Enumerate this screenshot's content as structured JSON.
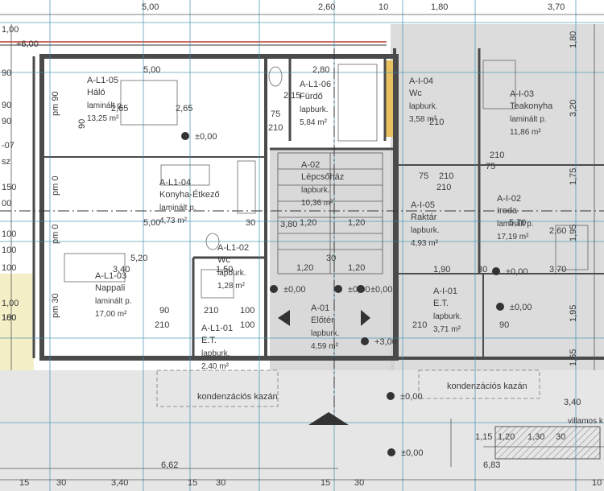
{
  "colors": {
    "wall": "#4a4a4a",
    "grid_blue": "#3a8fb0",
    "dim_line": "#555555",
    "axis_red": "#c0392b",
    "shade": "#d8d8d8",
    "yellow_strip": "#f4efc6",
    "orange_strip": "#e8c060"
  },
  "top_dims": [
    "5,00",
    "2,60",
    "10",
    "1,80",
    "3,70"
  ],
  "left_dims": [
    "1,00",
    "+6,00",
    "90",
    "90",
    "90",
    "-07",
    "sz",
    "150",
    "00",
    "100",
    "100",
    "100",
    "1,00",
    "100",
    "180"
  ],
  "rooms": [
    {
      "id": "A-L1-05",
      "name": "Háló",
      "finish": "laminált p.",
      "area": "13,25 m²",
      "area_num": 13.25
    },
    {
      "id": "A-L1-06",
      "name": "Fürdő",
      "finish": "lapburk.",
      "area": "5,84 m²",
      "area_num": 5.84
    },
    {
      "id": "A-I-04",
      "name": "Wc",
      "finish": "lapburk.",
      "area": "3,58 m²",
      "area_num": 3.58
    },
    {
      "id": "A-I-03",
      "name": "Teakonyha",
      "finish": "laminált p.",
      "area": "11,86 m²",
      "area_num": 11.86
    },
    {
      "id": "A-02",
      "name": "Lépcsőház",
      "finish": "lapburk.",
      "area": "10,36 m²",
      "area_num": 10.36
    },
    {
      "id": "A-L1-04",
      "name": "Konyha-Étkező",
      "finish": "laminált p.",
      "area": "4,73 m²",
      "area_num": 4.73
    },
    {
      "id": "A-I-05",
      "name": "Raktár",
      "finish": "lapburk.",
      "area": "4,93 m²",
      "area_num": 4.93
    },
    {
      "id": "A-I-02",
      "name": "Iroda",
      "finish": "laminált p.",
      "area": "17,19 m²",
      "area_num": 17.19
    },
    {
      "id": "A-L1-02",
      "name": "Wc",
      "finish": "lapburk.",
      "area": "1,28 m²",
      "area_num": 1.28
    },
    {
      "id": "A-L1-03",
      "name": "Nappali",
      "finish": "laminált p.",
      "area": "17,00 m²",
      "area_num": 17.0
    },
    {
      "id": "A-L1-01",
      "name": "E.T.",
      "finish": "lapburk.",
      "area": "2,40 m²",
      "area_num": 2.4
    },
    {
      "id": "A-01",
      "name": "Előtér",
      "finish": "lapburk.",
      "area": "4,59 m²",
      "area_num": 4.59
    },
    {
      "id": "A-I-01",
      "name": "E.T.",
      "finish": "lapburk.",
      "area": "3,71 m²",
      "area_num": 3.71
    }
  ],
  "room_labels": {
    "r0": {
      "id": "A-L1-05",
      "name": "Háló",
      "finish": "laminált p.",
      "area": "13,25 m²"
    },
    "r1": {
      "id": "A-L1-06",
      "name": "Fürdő",
      "finish": "lapburk.",
      "area": "5,84 m²"
    },
    "r2": {
      "id": "A-I-04",
      "name": "Wc",
      "finish": "lapburk.",
      "area": "3,58 m²"
    },
    "r3": {
      "id": "A-I-03",
      "name": "Teakonyha",
      "finish": "laminált p.",
      "area": "11,86 m²"
    },
    "r4": {
      "id": "A-02",
      "name": "Lépcsőház",
      "finish": "lapburk.",
      "area": "10,36 m²"
    },
    "r5": {
      "id": "A-L1-04",
      "name": "Konyha-Étkező",
      "finish": "laminált p.",
      "area": "4,73 m²"
    },
    "r6": {
      "id": "A-I-05",
      "name": "Raktár",
      "finish": "lapburk.",
      "area": "4,93 m²"
    },
    "r7": {
      "id": "A-I-02",
      "name": "Iroda",
      "finish": "laminált p.",
      "area": "17,19 m²"
    },
    "r8": {
      "id": "A-L1-02",
      "name": "Wc",
      "finish": "lapburk.",
      "area": "1,28 m²"
    },
    "r9": {
      "id": "A-L1-03",
      "name": "Nappali",
      "finish": "laminált p.",
      "area": "17,00 m²"
    },
    "r10": {
      "id": "A-L1-01",
      "name": "E.T.",
      "finish": "lapburk.",
      "area": "2,40 m²"
    },
    "r11": {
      "id": "A-01",
      "name": "Előtér",
      "finish": "lapburk.",
      "area": "4,59 m²"
    },
    "r12": {
      "id": "A-I-01",
      "name": "E.T.",
      "finish": "lapburk.",
      "area": "3,71 m²"
    }
  },
  "levels": [
    "±0,00",
    "±0,00",
    "±0,00",
    "+3,00",
    "±0,00",
    "±0,00",
    "±0,00",
    "±0,00",
    "±0,00"
  ],
  "interior_dims": [
    "5,00",
    "2,65",
    "2,65",
    "2,80",
    "2,15",
    "75",
    "210",
    "5,00",
    "5,20",
    "30",
    "3,80",
    "1,20",
    "1,20",
    "1,20",
    "1,20",
    "30",
    "5,70",
    "2,60",
    "3,40",
    "1,90",
    "30",
    "3,70",
    "1,50",
    "100",
    "90",
    "210",
    "210",
    "100",
    "210",
    "90",
    "210",
    "75",
    "210",
    "75",
    "210",
    "210"
  ],
  "misc_labels": {
    "pm_labels": [
      "pm 90",
      "pm 0",
      "pm 0",
      "pm 30",
      "90"
    ],
    "kazan1": "kondenzációs kazán",
    "kazan2": "kondenzációs kazán",
    "villamos": "villamos k"
  },
  "bottom_dims": [
    "6,62",
    "6,83",
    "3,40",
    "1,15",
    "1,20",
    "1,30",
    "30",
    "3,40",
    "15",
    "30",
    "15",
    "30",
    "15",
    "30",
    "10"
  ],
  "right_dims": [
    "1,80",
    "3,20",
    "1,75",
    "1,95",
    "1,95",
    "1,65"
  ]
}
